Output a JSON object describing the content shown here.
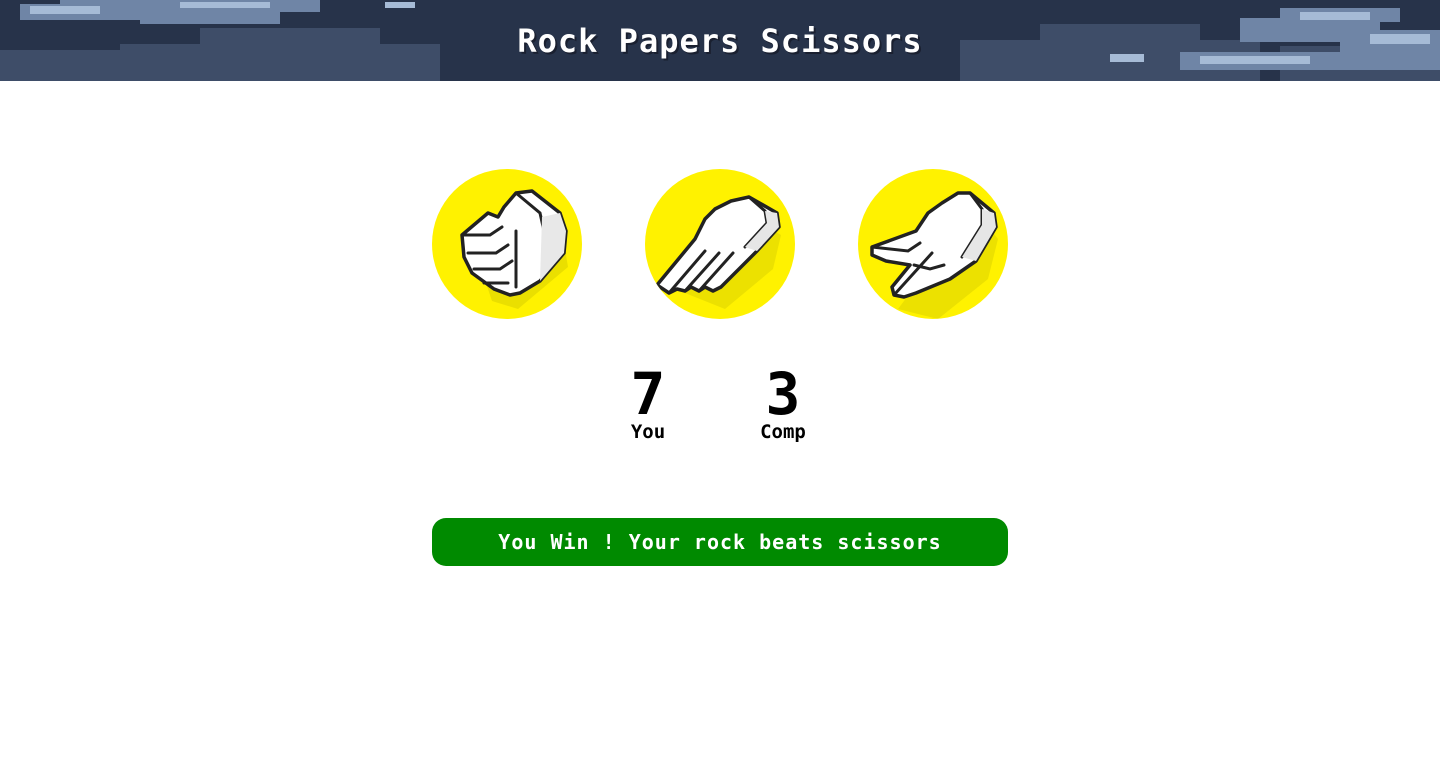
{
  "header": {
    "title": "Rock Papers Scissors"
  },
  "choices": [
    {
      "name": "rock",
      "icon": "rock-hand-icon"
    },
    {
      "name": "paper",
      "icon": "paper-hand-icon"
    },
    {
      "name": "scissors",
      "icon": "scissors-hand-icon"
    }
  ],
  "score": {
    "user": {
      "value": "7",
      "label": "You"
    },
    "computer": {
      "value": "3",
      "label": "Comp"
    }
  },
  "result": {
    "message": "You Win ! Your rock beats scissors"
  },
  "colors": {
    "header_bg": "#2d3a52",
    "choice_bg": "#fff200",
    "result_bg": "#008a00"
  }
}
